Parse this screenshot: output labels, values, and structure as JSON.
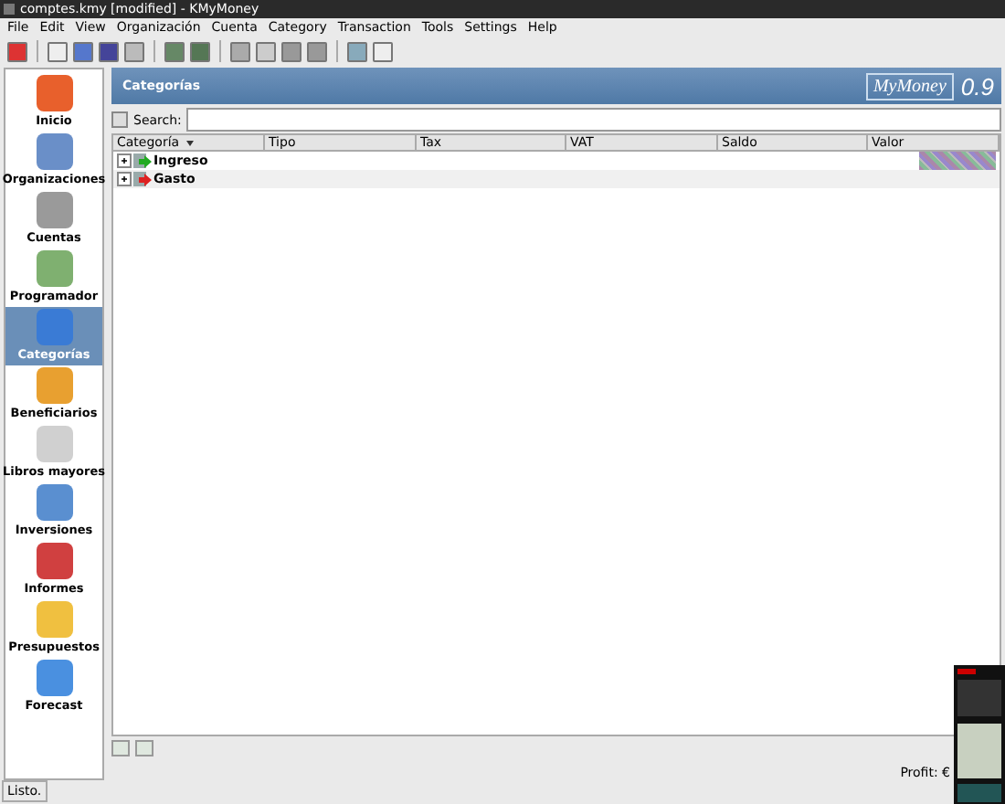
{
  "window": {
    "title": "comptes.kmy [modified] - KMyMoney"
  },
  "menu": [
    "File",
    "Edit",
    "View",
    "Organización",
    "Cuenta",
    "Category",
    "Transaction",
    "Tools",
    "Settings",
    "Help"
  ],
  "sidebar": {
    "items": [
      {
        "label": "Inicio",
        "selected": false
      },
      {
        "label": "Organizaciones",
        "selected": false
      },
      {
        "label": "Cuentas",
        "selected": false
      },
      {
        "label": "Programador",
        "selected": false
      },
      {
        "label": "Categorías",
        "selected": true
      },
      {
        "label": "Beneficiarios",
        "selected": false
      },
      {
        "label": "Libros mayores",
        "selected": false
      },
      {
        "label": "Inversiones",
        "selected": false
      },
      {
        "label": "Informes",
        "selected": false
      },
      {
        "label": "Presupuestos",
        "selected": false
      },
      {
        "label": "Forecast",
        "selected": false
      }
    ]
  },
  "header": {
    "title": "Categorías",
    "logo": "MyMoney",
    "version": "0.9"
  },
  "search": {
    "label": "Search:"
  },
  "table": {
    "columns": [
      "Categoría",
      "Tipo",
      "Tax",
      "VAT",
      "Saldo",
      "Valor"
    ],
    "rows": [
      {
        "name": "Ingreso",
        "kind": "income",
        "expanded": false
      },
      {
        "name": "Gasto",
        "kind": "expense",
        "expanded": false
      }
    ]
  },
  "footer": {
    "profit": "Profit: €"
  },
  "status_bar": "Listo."
}
